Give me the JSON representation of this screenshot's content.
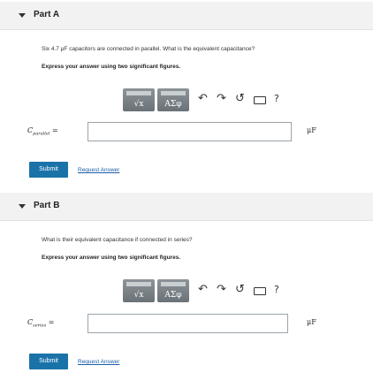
{
  "partA": {
    "title": "Part A",
    "question": "Six 4.7 μF capacitors are connected in parallel. What is the equivalent capacitance?",
    "instruction": "Express your answer using two significant figures.",
    "toolbar": {
      "templates_label": "√x",
      "greek_label": "ΑΣφ",
      "undo": "↶",
      "redo": "↷",
      "reset": "↺",
      "help": "?"
    },
    "var_symbol": "C",
    "var_subscript": "parallel",
    "equals": "=",
    "input_value": "",
    "unit": "μF",
    "submit_label": "Submit",
    "request_label": "Request Answer"
  },
  "partB": {
    "title": "Part B",
    "question": "What is their equivalent capacitance if connected in series?",
    "instruction": "Express your answer using two significant figures.",
    "toolbar": {
      "templates_label": "√x",
      "greek_label": "ΑΣφ",
      "undo": "↶",
      "redo": "↷",
      "reset": "↺",
      "help": "?"
    },
    "var_symbol": "C",
    "var_subscript": "series",
    "equals": "=",
    "input_value": "",
    "unit": "μF",
    "submit_label": "Submit",
    "request_label": "Request Answer"
  }
}
